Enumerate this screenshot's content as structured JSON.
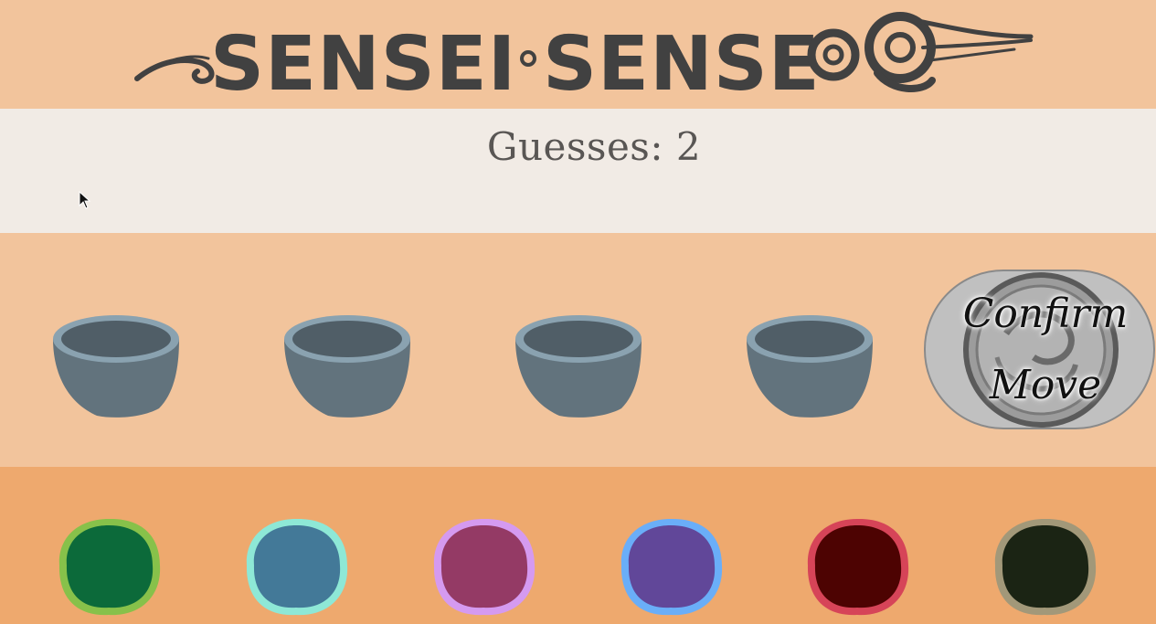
{
  "game": {
    "title": "SENSEI SENSE",
    "title_left": "SENSEI",
    "title_right": "SENSE",
    "guess_label": "Guesses: 2",
    "confirm_line1": "Confirm",
    "confirm_line2": "Move"
  },
  "colors": {
    "header_bg": "#f2c49c",
    "guess_bar_bg": "#f1ebe5",
    "pebble_tray_bg": "#eea96e",
    "bowl_body": "#62737d",
    "bowl_rim": "#8aa2b0",
    "bowl_inside": "#505e67"
  },
  "bowls": [
    {
      "name": "bowl-slot-1",
      "state": "empty"
    },
    {
      "name": "bowl-slot-2",
      "state": "empty"
    },
    {
      "name": "bowl-slot-3",
      "state": "empty"
    },
    {
      "name": "bowl-slot-4",
      "state": "empty"
    }
  ],
  "pebbles": [
    {
      "name": "green-pebble",
      "fill": "#0c6a3a",
      "border": "#87c14a"
    },
    {
      "name": "blue-pebble",
      "fill": "#437998",
      "border": "#8ee8d6"
    },
    {
      "name": "magenta-pebble",
      "fill": "#943a65",
      "border": "#d59af0"
    },
    {
      "name": "purple-pebble",
      "fill": "#614799",
      "border": "#6aaef8"
    },
    {
      "name": "dark-red-pebble",
      "fill": "#4d0302",
      "border": "#d64458"
    },
    {
      "name": "black-pebble",
      "fill": "#1b2414",
      "border": "#a29879"
    }
  ]
}
